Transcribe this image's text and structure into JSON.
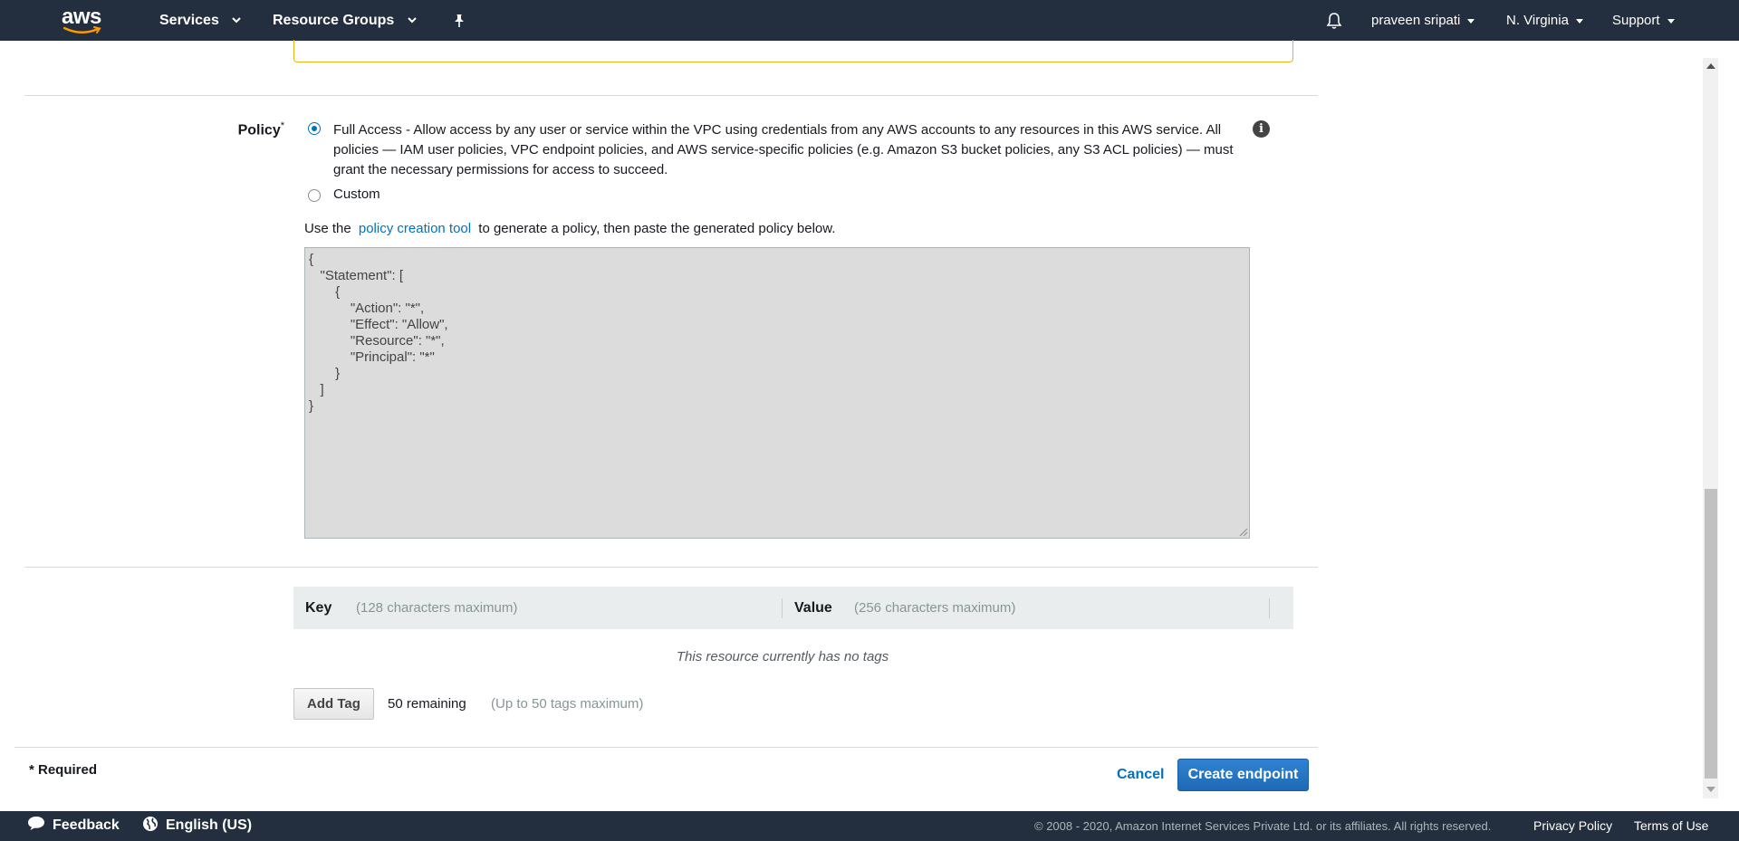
{
  "topnav": {
    "logo_text": "aws",
    "services": "Services",
    "resource_groups": "Resource Groups",
    "user": "praveen sripati",
    "region": "N. Virginia",
    "support": "Support"
  },
  "policy": {
    "label": "Policy",
    "required_mark": "*",
    "full_access_text": "Full Access - Allow access by any user or service within the VPC using credentials from any AWS accounts to any resources in this AWS service. All policies — IAM user policies, VPC endpoint policies, and AWS service-specific policies (e.g. Amazon S3 bucket policies, any S3 ACL policies) — must grant the necessary permissions for access to succeed.",
    "custom_text": "Custom",
    "full_access_selected": true,
    "use_the": "Use the",
    "policy_tool_link": "policy creation tool",
    "use_suffix": "to generate a policy, then paste the generated policy below.",
    "document": "{\n   \"Statement\": [\n       {\n           \"Action\": \"*\",\n           \"Effect\": \"Allow\",\n           \"Resource\": \"*\",\n           \"Principal\": \"*\"\n       }\n   ]\n}"
  },
  "tags": {
    "key_header": "Key",
    "key_placeholder": "(128 characters maximum)",
    "value_header": "Value",
    "value_placeholder": "(256 characters maximum)",
    "empty_message": "This resource currently has no tags",
    "add_tag_button": "Add Tag",
    "remaining": "50 remaining",
    "max_note": "(Up to 50 tags maximum)"
  },
  "form_footer": {
    "required_note": "* Required",
    "cancel": "Cancel",
    "create": "Create endpoint"
  },
  "footer": {
    "feedback": "Feedback",
    "language": "English (US)",
    "copyright": "© 2008 - 2020, Amazon Internet Services Private Ltd. or its affiliates. All rights reserved.",
    "privacy": "Privacy Policy",
    "terms": "Terms of Use"
  },
  "colors": {
    "nav_bg": "#232f3e",
    "link": "#0073bb",
    "primary_button": "#1f69b4",
    "warning_border": "#e7b416"
  }
}
